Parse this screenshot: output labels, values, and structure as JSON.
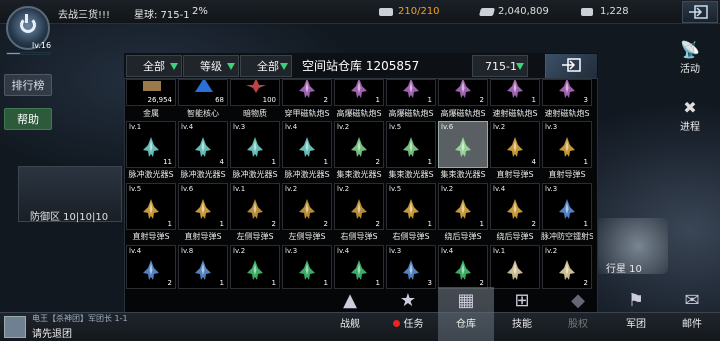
{
  "player": {
    "level": "lv.16"
  },
  "top": {
    "goal_text": "去战三货!!!",
    "planet_text": "星球: 715-1",
    "percent": "2%",
    "res": [
      {
        "icon": "ship-capacity-icon",
        "value": "210/210",
        "color": "#f0a024",
        "sep": ""
      },
      {
        "icon": "credits-icon",
        "value": "2,040,809",
        "color": "#e6e6e6"
      },
      {
        "icon": "crystal-icon",
        "value": "1,228",
        "color": "#e6e6e6"
      }
    ]
  },
  "left": {
    "rank_label": "排行榜",
    "help_label": "帮助",
    "defense_label": "防御区 10|10|10"
  },
  "right": {
    "activity_label": "活动",
    "progress_label": "进程",
    "planet_label": "行星 10"
  },
  "panel": {
    "filter1": "全部",
    "filter2": "等级",
    "filter3": "全部",
    "title": "空间站仓库 1205857",
    "location": "715-1"
  },
  "top_labels": [
    {
      "text": "金属",
      "count": "26,954",
      "icon": "metal-icon"
    },
    {
      "text": "智能核心",
      "count": "68",
      "icon": "smart-core-icon"
    },
    {
      "text": "暗物质",
      "count": "100",
      "icon": "dark-matter-icon"
    },
    {
      "text": "穿甲磁轨炮S",
      "count": "2"
    },
    {
      "text": "高爆磁轨炮S",
      "count": "1"
    },
    {
      "text": "高爆磁轨炮S",
      "count": "1"
    },
    {
      "text": "高爆磁轨炮S",
      "count": "2"
    },
    {
      "text": "速射磁轨炮S",
      "count": "1"
    },
    {
      "text": "速射磁轨炮S",
      "count": "3"
    }
  ],
  "rows": [
    {
      "items": [
        {
          "lvl": "lv.1",
          "count": "11",
          "name": "脉冲激光器S",
          "color": "#6fd0c8"
        },
        {
          "lvl": "lv.4",
          "count": "4",
          "name": "脉冲激光器S",
          "color": "#6fd0c8"
        },
        {
          "lvl": "lv.3",
          "count": "1",
          "name": "脉冲激光器S",
          "color": "#6fd0c8"
        },
        {
          "lvl": "lv.4",
          "count": "1",
          "name": "脉冲激光器S",
          "color": "#6fd0c8"
        },
        {
          "lvl": "lv.2",
          "count": "2",
          "name": "集束激光器S",
          "color": "#7fd08a"
        },
        {
          "lvl": "lv.5",
          "count": "1",
          "name": "集束激光器S",
          "color": "#7fd08a"
        },
        {
          "lvl": "lv.6",
          "count": "",
          "name": "集束激光器S",
          "color": "#9fe09a",
          "selected": true
        },
        {
          "lvl": "lv.2",
          "count": "4",
          "name": "直射导弹S",
          "color": "#d9a83c"
        },
        {
          "lvl": "lv.3",
          "count": "1",
          "name": "直射导弹S",
          "color": "#d9a83c"
        }
      ]
    },
    {
      "items": [
        {
          "lvl": "lv.5",
          "count": "1",
          "name": "直射导弹S",
          "color": "#d9a83c"
        },
        {
          "lvl": "lv.6",
          "count": "1",
          "name": "直射导弹S",
          "color": "#d9a83c"
        },
        {
          "lvl": "lv.1",
          "count": "2",
          "name": "左侧导弹S",
          "color": "#c99a3a"
        },
        {
          "lvl": "lv.2",
          "count": "2",
          "name": "左侧导弹S",
          "color": "#c99a3a"
        },
        {
          "lvl": "lv.2",
          "count": "2",
          "name": "右侧导弹S",
          "color": "#c99a3a"
        },
        {
          "lvl": "lv.5",
          "count": "1",
          "name": "右侧导弹S",
          "color": "#d9a83c"
        },
        {
          "lvl": "lv.2",
          "count": "1",
          "name": "绕后导弹S",
          "color": "#d9a83c"
        },
        {
          "lvl": "lv.4",
          "count": "2",
          "name": "绕后导弹S",
          "color": "#d9a83c"
        },
        {
          "lvl": "lv.3",
          "count": "1",
          "name": "脉冲防空镭射S",
          "color": "#5a8fd6"
        }
      ]
    },
    {
      "items": [
        {
          "lvl": "lv.4",
          "count": "2",
          "name": "",
          "color": "#5a8fd6"
        },
        {
          "lvl": "lv.8",
          "count": "1",
          "name": "",
          "color": "#5a8fd6"
        },
        {
          "lvl": "lv.2",
          "count": "1",
          "name": "",
          "color": "#3fbf70"
        },
        {
          "lvl": "lv.3",
          "count": "1",
          "name": "",
          "color": "#3fbf70"
        },
        {
          "lvl": "lv.4",
          "count": "1",
          "name": "",
          "color": "#3fbf70"
        },
        {
          "lvl": "lv.3",
          "count": "3",
          "name": "",
          "color": "#5a8fd6"
        },
        {
          "lvl": "lv.4",
          "count": "2",
          "name": "",
          "color": "#3fbf70"
        },
        {
          "lvl": "lv.1",
          "count": "",
          "name": "",
          "color": "#e0d0a0"
        },
        {
          "lvl": "lv.2",
          "count": "2",
          "name": "",
          "color": "#e0d0a0"
        }
      ]
    }
  ],
  "chat": {
    "sender": "电王【杀神团】军团长 1-1",
    "message": "请先退团"
  },
  "nav": [
    {
      "label": "战舰",
      "icon": "warship-icon",
      "glyph": "▲"
    },
    {
      "label": "任务",
      "icon": "mission-icon",
      "glyph": "★",
      "dot": true
    },
    {
      "label": "仓库",
      "icon": "warehouse-icon",
      "glyph": "▦",
      "active": true
    },
    {
      "label": "技能",
      "icon": "skill-icon",
      "glyph": "⊞"
    },
    {
      "label": "股权",
      "icon": "equity-icon",
      "glyph": "◆",
      "disabled": true
    },
    {
      "label": "军团",
      "icon": "legion-icon",
      "glyph": "⚑"
    },
    {
      "label": "邮件",
      "icon": "mail-icon",
      "glyph": "✉"
    }
  ]
}
